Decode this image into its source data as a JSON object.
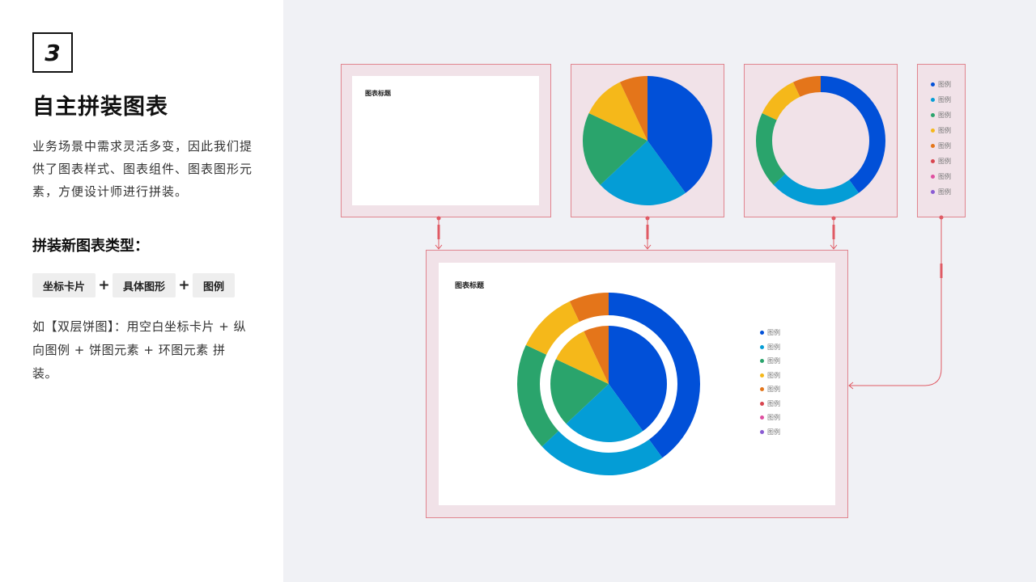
{
  "step_number": "3",
  "title": "自主拼装图表",
  "description": "业务场景中需求灵活多变，因此我们提供了图表样式、图表组件、图表图形元素，方便设计师进行拼装。",
  "subtitle": "拼装新图表类型：",
  "tags": [
    "坐标卡片",
    "具体图形",
    "图例"
  ],
  "plus_sign": "+",
  "example_text": "如【双层饼图】：用空白坐标卡片 + 纵向图例 + 饼图元素 + 环图元素 拼装。",
  "card_title": "图表标题",
  "legend_label": "图例",
  "colors": {
    "frame_fill": "#f1e2e8",
    "frame_border": "#e0848e",
    "connector": "#e05a64"
  },
  "chart_data": {
    "type": "pie",
    "categories": [
      "blue",
      "cyan",
      "green",
      "yellow",
      "orange"
    ],
    "values": [
      40,
      23,
      19,
      11,
      7
    ],
    "colors": [
      "#0150d8",
      "#049dd6",
      "#2aa46c",
      "#f5b81a",
      "#e4751a"
    ],
    "legend_colors": [
      "#0150d8",
      "#049dd6",
      "#2aa46c",
      "#f5b81a",
      "#e4751a",
      "#d8454f",
      "#df4fa0",
      "#8a5bd3"
    ]
  }
}
